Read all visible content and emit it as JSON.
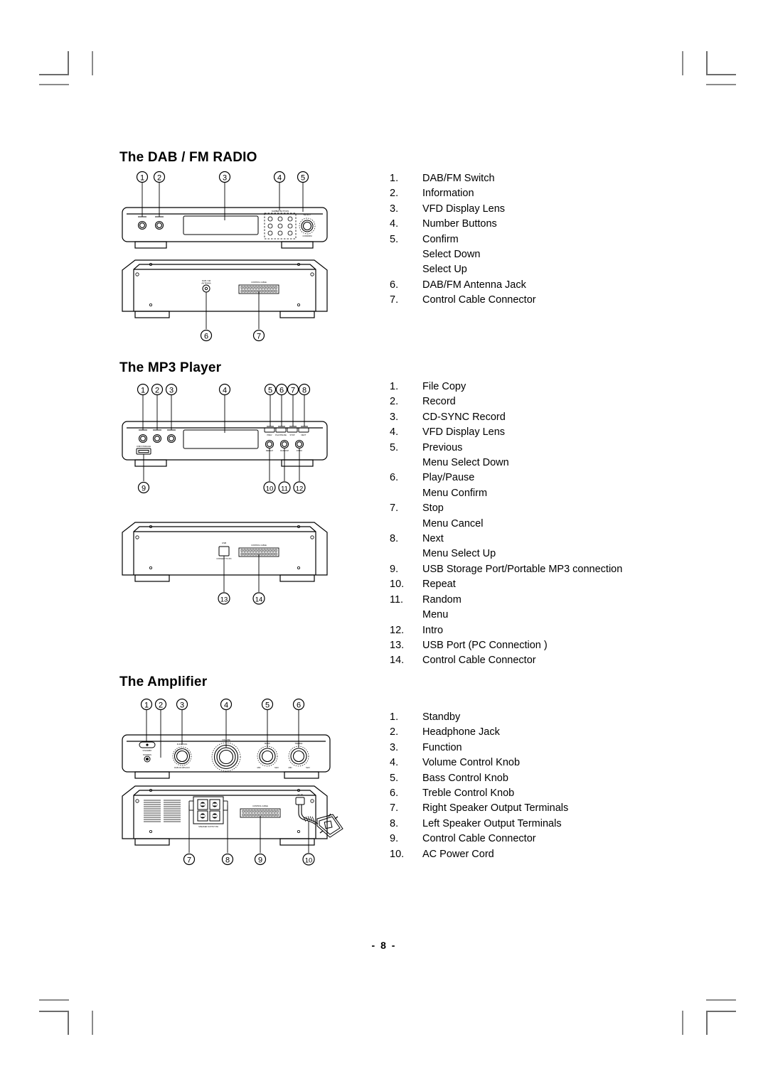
{
  "page": {
    "number_label": "- 8 -"
  },
  "sections": [
    {
      "id": "dab-fm-radio",
      "title": "The DAB / FM RADIO",
      "callouts": [
        {
          "num": "1.",
          "label": "DAB/FM Switch"
        },
        {
          "num": "2.",
          "label": "Information"
        },
        {
          "num": "3.",
          "label": "VFD Display Lens"
        },
        {
          "num": "4.",
          "label": "Number Buttons"
        },
        {
          "num": "5.",
          "label": "Confirm"
        },
        {
          "num": "",
          "label": "Select Down"
        },
        {
          "num": "",
          "label": "Select Up"
        },
        {
          "num": "6.",
          "label": "DAB/FM Antenna Jack"
        },
        {
          "num": "7.",
          "label": "Control Cable Connector"
        }
      ],
      "front_markers": [
        "1",
        "2",
        "3",
        "4",
        "5"
      ],
      "rear_markers": [
        "6",
        "7"
      ],
      "panel_text": {
        "number_buttons": "NUMBER BUTTONS",
        "tune_knob": "SELECT",
        "tune_knob_sub": "CONFIRM",
        "antenna": "DAB / FM ANTENNA",
        "control_cable": "CONTROL CABLE"
      }
    },
    {
      "id": "mp3-player",
      "title": "The MP3 Player",
      "callouts": [
        {
          "num": "1.",
          "label": "File Copy"
        },
        {
          "num": "2.",
          "label": "Record"
        },
        {
          "num": "3.",
          "label": "CD-SYNC Record"
        },
        {
          "num": "4.",
          "label": "VFD Display Lens"
        },
        {
          "num": "5.",
          "label": "Previous"
        },
        {
          "num": "",
          "label": "Menu Select Down"
        },
        {
          "num": "6.",
          "label": "Play/Pause"
        },
        {
          "num": "",
          "label": "Menu Confirm"
        },
        {
          "num": "7.",
          "label": "Stop"
        },
        {
          "num": "",
          "label": "Menu Cancel"
        },
        {
          "num": "8.",
          "label": "Next"
        },
        {
          "num": "",
          "label": "Menu Select Up"
        },
        {
          "num": "9.",
          "label": "USB Storage Port/Portable MP3 connection"
        },
        {
          "num": "10.",
          "label": "Repeat"
        },
        {
          "num": "11.",
          "label": "Random"
        },
        {
          "num": "",
          "label": "Menu"
        },
        {
          "num": "12.",
          "label": "Intro"
        },
        {
          "num": "13.",
          "label": "USB Port (PC Connection )"
        },
        {
          "num": "14.",
          "label": "Control Cable Connector"
        }
      ],
      "front_markers": [
        "1",
        "2",
        "3",
        "4",
        "5",
        "6",
        "7",
        "8",
        "9",
        "10",
        "11",
        "12"
      ],
      "rear_markers": [
        "13",
        "14"
      ],
      "panel_text": {
        "usb_front": "USB STORAGE",
        "buttons_row": [
          "PREV",
          "PLAY/PAUSE",
          "STOP",
          "NEXT"
        ],
        "knobs_row": [
          "REPEAT",
          "RANDOM",
          "INTRO"
        ],
        "usb_rear": "USB CONNECT TO PC",
        "control_cable": "CONTROL CABLE"
      }
    },
    {
      "id": "amplifier",
      "title": "The Amplifier",
      "callouts": [
        {
          "num": "1.",
          "label": "Standby"
        },
        {
          "num": "2.",
          "label": "Headphone Jack"
        },
        {
          "num": "3.",
          "label": "Function"
        },
        {
          "num": "4.",
          "label": "Volume Control Knob"
        },
        {
          "num": "5.",
          "label": "Bass Control Knob"
        },
        {
          "num": "6.",
          "label": "Treble Control Knob"
        },
        {
          "num": "7.",
          "label": "Right Speaker Output Terminals"
        },
        {
          "num": "8.",
          "label": "Left Speaker Output Terminals"
        },
        {
          "num": "9.",
          "label": "Control Cable Connector"
        },
        {
          "num": "10.",
          "label": "AC Power Cord"
        }
      ],
      "front_markers": [
        "1",
        "2",
        "3",
        "4",
        "5",
        "6"
      ],
      "rear_markers": [
        "7",
        "8",
        "9",
        "10"
      ],
      "panel_text": {
        "standby": "STANDBY",
        "phones": "PHONES",
        "function": "FUNCTION",
        "function_sub": "DAB  CD  MP3  AUX",
        "volume": "VOLUME",
        "bass": "BASS",
        "bass_min": "MIN",
        "bass_max": "MAX",
        "treble": "TREBLE",
        "treble_min": "MIN",
        "treble_max": "MAX",
        "speaker_terminals": "SPEAKER OUTPUT 8Ω",
        "control_cable": "CONTROL CABLE",
        "ac_in": "AC IN"
      }
    }
  ],
  "colors": {
    "ink": "#000000",
    "crop_mark": "#6b6b6b",
    "crop_mark_light": "#8a8a8a"
  }
}
